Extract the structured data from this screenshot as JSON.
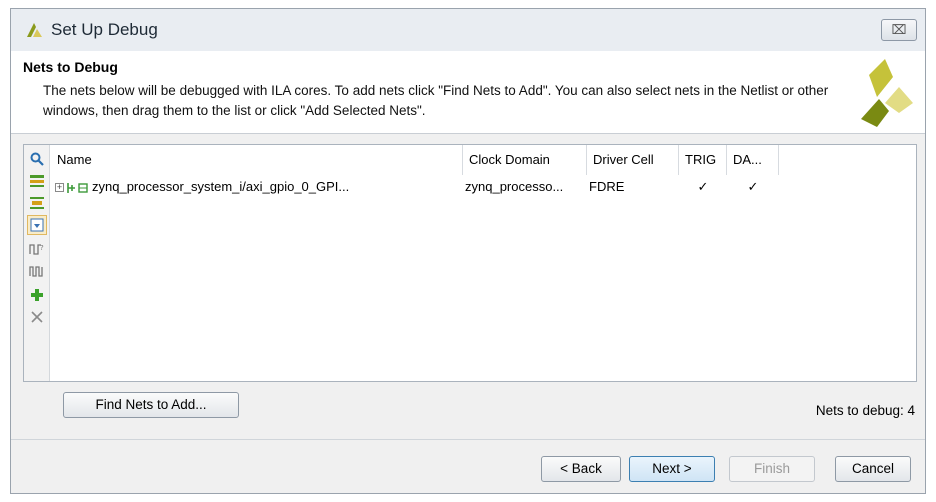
{
  "window": {
    "title": "Set Up Debug",
    "close_label": "⌧",
    "close_icon": "close-icon"
  },
  "header": {
    "title": "Nets to Debug",
    "description": "The nets below will be debugged with ILA cores. To add nets click \"Find Nets to Add\". You can also select nets in the Netlist or other windows, then drag them to the list or click \"Add Selected Nets\"."
  },
  "toolbar": {
    "tools": [
      {
        "icon": "search-icon",
        "glyph": "🔍"
      },
      {
        "icon": "collapse-all-icon",
        "glyph": "↔"
      },
      {
        "icon": "expand-all-icon",
        "glyph": "⇕"
      },
      {
        "icon": "select-all-icon",
        "glyph": "⬇"
      },
      {
        "icon": "probe-type-icon",
        "glyph": "⎍"
      },
      {
        "icon": "waveform-icon",
        "glyph": "⎍"
      },
      {
        "icon": "add-icon",
        "glyph": "+"
      },
      {
        "icon": "remove-icon",
        "glyph": "✕"
      }
    ]
  },
  "table": {
    "columns": [
      "Name",
      "Clock Domain",
      "Driver Cell",
      "TRIG",
      "DA..."
    ],
    "rows": [
      {
        "name": "zynq_processor_system_i/axi_gpio_0_GPI...",
        "clock_domain": "zynq_processo...",
        "driver_cell": "FDRE",
        "trig": "✓",
        "data": "✓"
      }
    ]
  },
  "actions": {
    "find_nets": "Find Nets to Add...",
    "nets_count": "Nets to debug: 4"
  },
  "footer": {
    "back": "< Back",
    "next": "Next >",
    "finish": "Finish",
    "cancel": "Cancel"
  },
  "colors": {
    "accent": "#3c7fb1",
    "header_bg": "#ffffff",
    "dialog_bg": "#f0f0f0",
    "logo_green": "#7a8a12",
    "logo_yellow": "#e2d86a"
  }
}
